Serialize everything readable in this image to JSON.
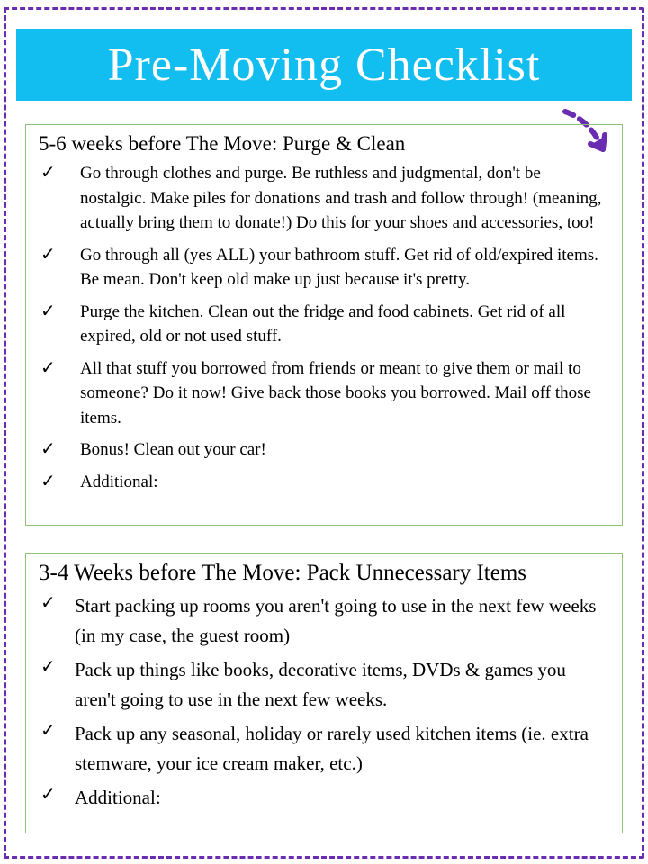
{
  "title": "Pre-Moving Checklist",
  "sections": [
    {
      "heading": "5-6 weeks before The Move: Purge & Clean",
      "items": [
        "Go through clothes and purge.  Be ruthless and judgmental, don't be nostalgic.  Make piles for donations and trash and follow through! (meaning, actually bring them to donate!)  Do this for your shoes and accessories, too!",
        "Go through all (yes ALL) your bathroom stuff.  Get rid of old/expired items.  Be mean.  Don't keep old make up just because it's pretty.",
        "Purge the kitchen.  Clean out the fridge and food cabinets.  Get rid of all expired, old or not used stuff.",
        "All that stuff you borrowed from friends or meant to give them or mail to someone?  Do it now!  Give back those books you borrowed.  Mail off those items.",
        "Bonus!  Clean out your car!",
        "Additional:"
      ]
    },
    {
      "heading": "3-4 Weeks before The Move: Pack Unnecessary Items",
      "items": [
        "Start packing up rooms you aren't going to use in the next few weeks (in my case, the guest room)",
        "Pack up things like books, decorative items, DVDs & games you aren't going to use in the next few weeks.",
        "Pack up any seasonal, holiday or rarely used kitchen items (ie. extra stemware, your ice cream maker, etc.)",
        "Additional:"
      ]
    }
  ],
  "colors": {
    "banner": "#12bdef",
    "border": "#6a2cb0",
    "boxBorder": "#8fc379"
  }
}
